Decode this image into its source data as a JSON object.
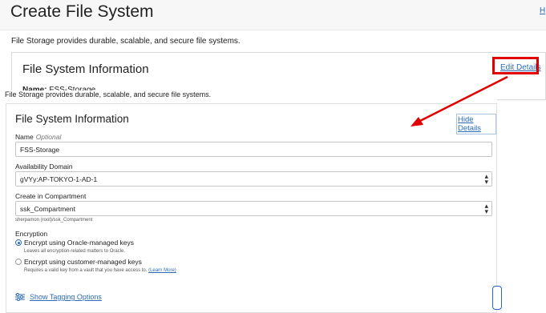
{
  "background": {
    "page_title": "Create File System",
    "help_link": "H",
    "intro": "File Storage provides durable, scalable, and secure file systems.",
    "card": {
      "title": "File System Information",
      "edit_link": "Edit Details",
      "name_label": "Name:",
      "name_value": "FSS-Storage"
    }
  },
  "overlay": {
    "intro": "File Storage provides durable, scalable, and secure file systems.",
    "title": "File System Information",
    "hide_link": "Hide Details",
    "name": {
      "label": "Name",
      "optional": "Optional",
      "value": "FSS-Storage"
    },
    "availability_domain": {
      "label": "Availability Domain",
      "value": "gVYy:AP-TOKYO-1-AD-1"
    },
    "compartment": {
      "label": "Create in Compartment",
      "value": "ssk_Compartment",
      "path": "sherpamon (root)/ssk_Compartment"
    },
    "encryption": {
      "label": "Encryption",
      "option1": {
        "label": "Encrypt using Oracle-managed keys",
        "hint": "Leaves all encryption-related matters to Oracle.",
        "selected": true
      },
      "option2": {
        "label": "Encrypt using customer-managed keys",
        "hint": "Requires a valid key from a vault that you have access to.",
        "learn_more": "(Learn More)",
        "selected": false
      }
    },
    "tagging_link": "Show Tagging Options"
  },
  "colors": {
    "accent": "#2a6ab7",
    "annotation": "#e00000"
  }
}
